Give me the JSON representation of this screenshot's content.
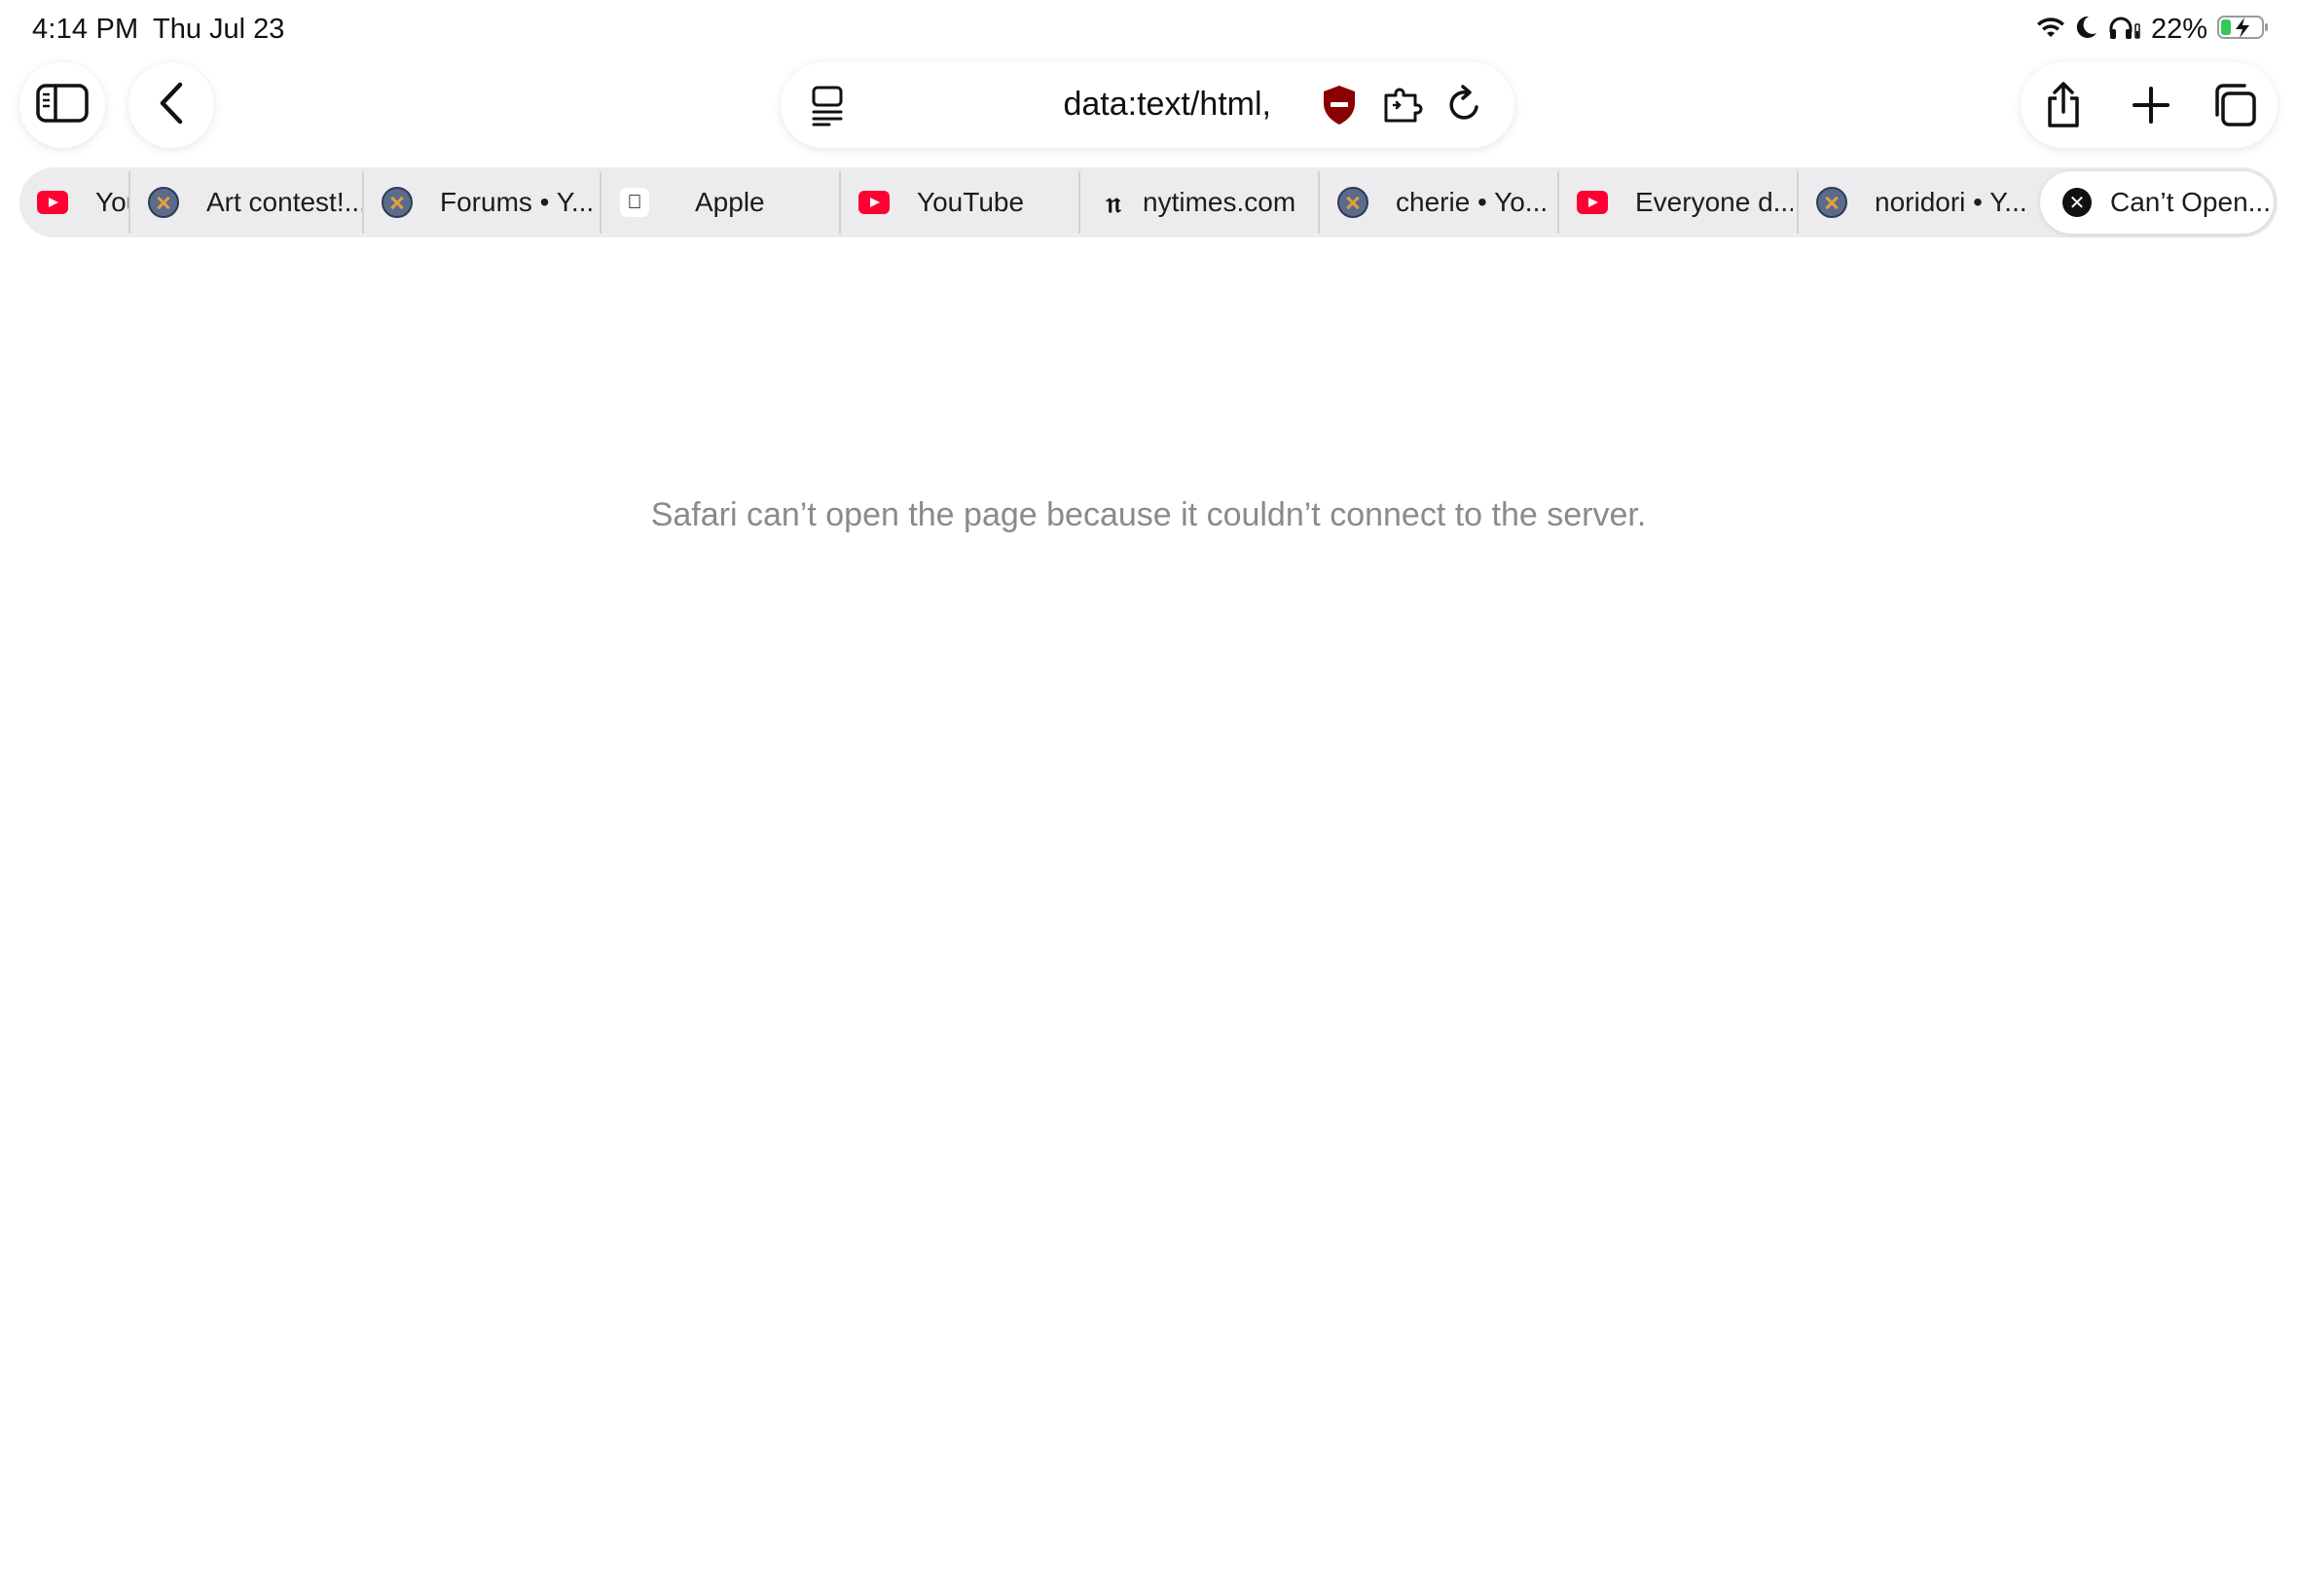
{
  "status_bar": {
    "time": "4:14 PM",
    "date": "Thu Jul 23",
    "battery_percent": "22%",
    "icons": [
      "wifi-icon",
      "moon-icon",
      "headphones-icon",
      "battery-charging-icon"
    ]
  },
  "toolbar": {
    "url": "data:text/html,",
    "left_icons": [
      "sidebar-icon",
      "back-chevron-icon"
    ],
    "address_icons": [
      "reader-page-menu-icon",
      "shield-blocker-icon",
      "extension-icon",
      "reload-icon"
    ],
    "right_icons": [
      "share-icon",
      "plus-icon",
      "tabs-overview-icon"
    ]
  },
  "tabs": [
    {
      "title": "You",
      "favicon": "youtube"
    },
    {
      "title": "Art contest!...",
      "favicon": "globe"
    },
    {
      "title": "Forums • Y...",
      "favicon": "globe"
    },
    {
      "title": "Apple",
      "favicon": "apple"
    },
    {
      "title": "YouTube",
      "favicon": "youtube"
    },
    {
      "title": "nytimes.com",
      "favicon": "nyt"
    },
    {
      "title": "cherie • Yo...",
      "favicon": "globe"
    },
    {
      "title": "Everyone d...",
      "favicon": "youtube"
    },
    {
      "title": "noridori • Y...",
      "favicon": "globe"
    },
    {
      "title": "Can’t Open...",
      "favicon": "close-x",
      "active": true
    }
  ],
  "content": {
    "error_message": "Safari can’t open the page because it couldn’t connect to the server."
  },
  "colors": {
    "tab_bar_bg": "#ececee",
    "error_text": "#8a8a8e",
    "shield": "#8b0000",
    "youtube_red": "#ff0033"
  }
}
